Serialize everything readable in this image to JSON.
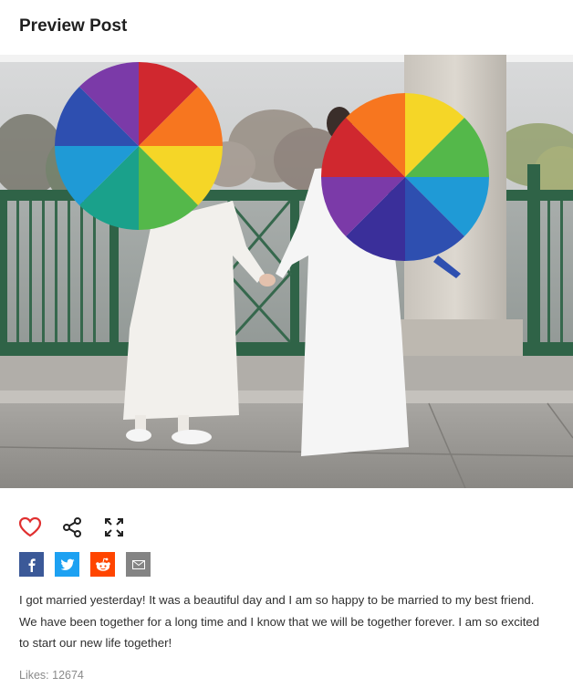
{
  "page": {
    "title": "Preview Post"
  },
  "photo": {
    "alt": ""
  },
  "actions": [
    {
      "name": "like",
      "icon": "heart-icon"
    },
    {
      "name": "share",
      "icon": "share-icon"
    },
    {
      "name": "expand",
      "icon": "expand-icon"
    }
  ],
  "share_buttons": [
    {
      "name": "facebook",
      "icon": "facebook-icon",
      "color": "#3b5998"
    },
    {
      "name": "twitter",
      "icon": "twitter-icon",
      "color": "#1da1f2"
    },
    {
      "name": "reddit",
      "icon": "reddit-icon",
      "color": "#ff4500"
    },
    {
      "name": "email",
      "icon": "email-icon",
      "color": "#848484"
    }
  ],
  "post": {
    "caption": "I got married yesterday! It was a beautiful day and I am so happy to be married to my best friend. We have been together for a long time and I know that we will be together forever. I am so excited to start our new life together!",
    "likes": "Likes: 12674"
  },
  "colors": {
    "heart": "#e03030"
  }
}
